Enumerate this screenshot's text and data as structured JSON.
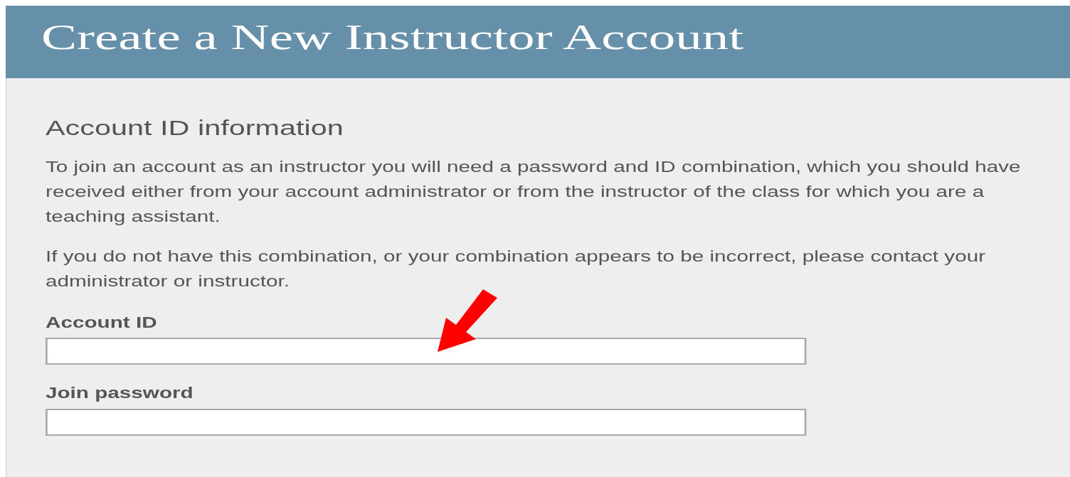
{
  "header": {
    "title": "Create a New Instructor Account"
  },
  "section": {
    "heading": "Account ID information",
    "paragraphs": [
      "To join an account as an instructor you will need a password and ID combination, which you should have received either from your account administrator or from the instructor of the class for which you are a teaching assistant.",
      "If you do not have this combination, or your combination appears to be incorrect, please contact your administrator or instructor."
    ]
  },
  "fields": [
    {
      "label": "Account ID"
    },
    {
      "label": "Join password"
    }
  ]
}
